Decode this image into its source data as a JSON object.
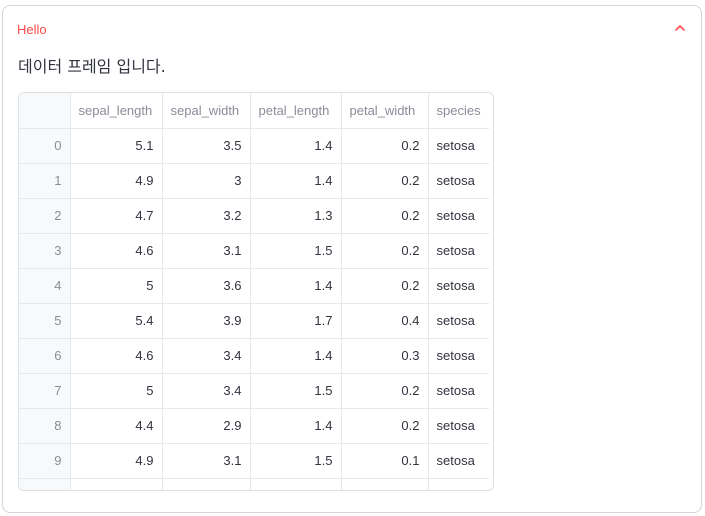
{
  "expander": {
    "title": "Hello",
    "expanded": true,
    "text": "데이터 프레임 입니다."
  },
  "dataframe": {
    "columns": [
      "",
      "sepal_length",
      "sepal_width",
      "petal_length",
      "petal_width",
      "species"
    ],
    "rows": [
      [
        "0",
        "5.1",
        "3.5",
        "1.4",
        "0.2",
        "setosa"
      ],
      [
        "1",
        "4.9",
        "3",
        "1.4",
        "0.2",
        "setosa"
      ],
      [
        "2",
        "4.7",
        "3.2",
        "1.3",
        "0.2",
        "setosa"
      ],
      [
        "3",
        "4.6",
        "3.1",
        "1.5",
        "0.2",
        "setosa"
      ],
      [
        "4",
        "5",
        "3.6",
        "1.4",
        "0.2",
        "setosa"
      ],
      [
        "5",
        "5.4",
        "3.9",
        "1.7",
        "0.4",
        "setosa"
      ],
      [
        "6",
        "4.6",
        "3.4",
        "1.4",
        "0.3",
        "setosa"
      ],
      [
        "7",
        "5",
        "3.4",
        "1.5",
        "0.2",
        "setosa"
      ],
      [
        "8",
        "4.4",
        "2.9",
        "1.4",
        "0.2",
        "setosa"
      ],
      [
        "9",
        "4.9",
        "3.1",
        "1.5",
        "0.1",
        "setosa"
      ],
      [
        "",
        "",
        "",
        "",
        "",
        ""
      ]
    ]
  },
  "colors": {
    "accent": "#ff4b4b",
    "text": "#31333f",
    "muted": "#8a8d97",
    "border": "#d6d6d9"
  }
}
